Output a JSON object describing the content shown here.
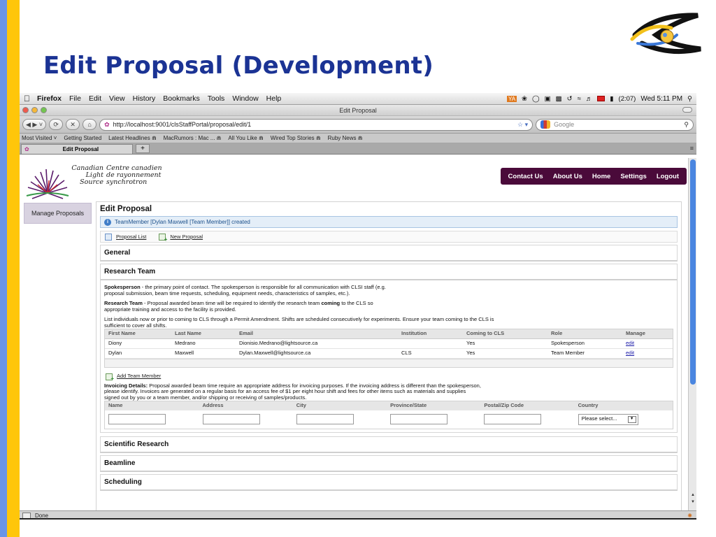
{
  "slide": {
    "title": "Edit Proposal (Development)"
  },
  "mac_menubar": {
    "apple_icon": "apple-icon",
    "items": [
      "Firefox",
      "File",
      "Edit",
      "View",
      "History",
      "Bookmarks",
      "Tools",
      "Window",
      "Help"
    ],
    "battery": "(2:07)",
    "clock": "Wed 5:11 PM"
  },
  "window": {
    "title": "Edit Proposal"
  },
  "navbar": {
    "url": "http://localhost:9001/clsStaffPortal/proposal/edit/1",
    "search_placeholder": "Google"
  },
  "bookmarks": [
    "Most Visited ˅",
    "Getting Started",
    "Latest Headlines ⋒",
    "MacRumors : Mac ... ⋒",
    "All You Like ⋒",
    "Wired Top Stories ⋒",
    "Ruby News ⋒"
  ],
  "tab": {
    "title": "Edit Proposal",
    "new_tab": "+"
  },
  "site": {
    "logo_en": [
      "Canadian",
      "Light",
      "Source"
    ],
    "logo_fr": [
      "Centre canadien",
      "de rayonnement",
      "synchrotron"
    ],
    "nav": [
      "Contact Us",
      "About Us",
      "Home",
      "Settings",
      "Logout"
    ],
    "sidebar_item": "Manage Proposals"
  },
  "panel": {
    "title": "Edit Proposal",
    "notice": "TeamMember [Dylan Maxwell [Team Member]] created",
    "links": {
      "list": "Proposal List",
      "new": "New Proposal"
    },
    "sections": {
      "general": "General",
      "research_team": "Research Team",
      "scientific": "Scientific Research",
      "beamline": "Beamline",
      "scheduling": "Scheduling"
    },
    "spokesperson": {
      "label": "Spokesperson",
      "text": " - the primary point of contact. The spokesperson is responsible for all communication with CLSI staff (e.g. proposal submission, beam time requests, scheduling, equipment needs, characteristics of samples, etc.)."
    },
    "research_team_text": {
      "label": "Research Team",
      "text_a": " - Proposal awarded beam time will be required to identify the research team ",
      "bold": "coming",
      "text_b": " to the CLS so appropriate training and access to the facility is provided."
    },
    "list_text": "List individuals now or prior to coming to CLS through a Permit Amendment. Shifts are scheduled consecutively for experiments. Ensure your team coming to the CLS is sufficient to cover all shifts.",
    "team_table": {
      "headers": [
        "First Name",
        "Last Name",
        "Email",
        "Institution",
        "Coming to CLS",
        "Role",
        "Manage"
      ],
      "rows": [
        [
          "Diony",
          "Medrano",
          "Dionisio.Medrano@lightsource.ca",
          "",
          "Yes",
          "Spokesperson",
          "edit"
        ],
        [
          "Dylan",
          "Maxwell",
          "Dylan.Maxwell@lightsource.ca",
          "CLS",
          "Yes",
          "Team Member",
          "edit"
        ]
      ]
    },
    "add_member": "Add Team Member",
    "invoicing": {
      "label": "Invoicing Details:",
      "text": " Proposal awarded beam time require an appropriate address for invoicing purposes. If the invoicing address is different than the spokesperson, please identify. Invoices are generated on a regular basis for an access fee of $1 per eight hour shift and fees for other items such as materials and supplies signed out by you or a team member, and/or shipping or receiving of samples/products.",
      "headers": [
        "Name",
        "Address",
        "City",
        "Province/State",
        "Postal/Zip Code",
        "Country"
      ],
      "country_value": "Please select..."
    }
  },
  "status": {
    "text": "Done"
  }
}
